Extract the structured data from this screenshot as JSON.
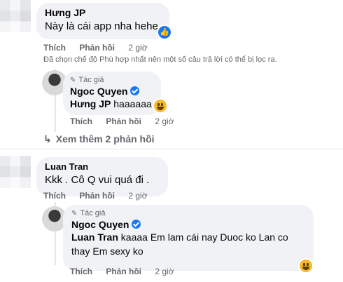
{
  "comments": [
    {
      "author": "Hưng JP",
      "text": "Này là cái app nha hehe",
      "actions": [
        "Thích",
        "Phản hồi"
      ],
      "time": "2 giờ"
    },
    {
      "author": "Luan Tran",
      "text": "Kkk . Cô Q vui quá đi .",
      "actions": [
        "Thích",
        "Phản hồi"
      ],
      "time": "2 giờ"
    }
  ],
  "filter_notice": "Đã chọn chế độ Phù hợp nhất nên một số câu trả lời có thể bị lọc ra.",
  "replies": [
    {
      "author_tag": "Tác giả",
      "author": "Ngoc Quyen",
      "mention": "Hưng JP",
      "text": "haaaaaa",
      "actions": [
        "Thích",
        "Phản hồi"
      ],
      "time": "2 giờ"
    },
    {
      "author_tag": "Tác giả",
      "author": "Ngoc Quyen",
      "mention": "Luan Tran",
      "text_line1": "kaaaa Em lam cái nay Duoc ko Lan co",
      "text_line2": "thay Em sexy ko",
      "actions": [
        "Thích",
        "Phản hồi"
      ],
      "time": "2 giờ"
    }
  ],
  "more_replies": "Xem thêm 2 phản hồi"
}
